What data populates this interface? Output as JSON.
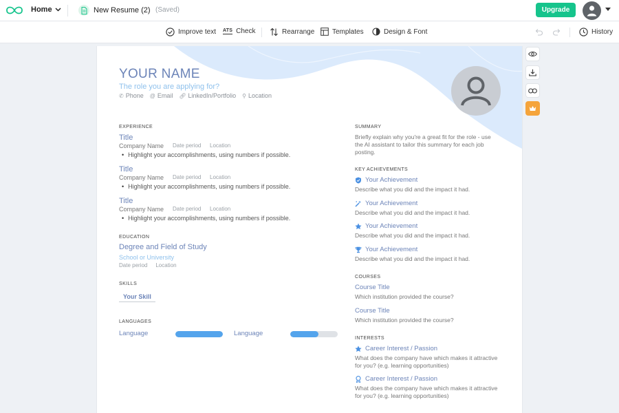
{
  "topbar": {
    "home_label": "Home",
    "document_title": "New Resume (2)",
    "save_status": "(Saved)",
    "upgrade_label": "Upgrade"
  },
  "toolbar": {
    "improve_text": "Improve text",
    "ats_badge": "ATS",
    "check": "Check",
    "rearrange": "Rearrange",
    "templates": "Templates",
    "design_font": "Design & Font",
    "history": "History"
  },
  "resume": {
    "name": "YOUR NAME",
    "role": "The role you are applying for?",
    "contacts": {
      "phone": "Phone",
      "email": "Email",
      "linkedin": "LinkedIn/Portfolio",
      "location": "Location"
    },
    "experience": {
      "heading": "EXPERIENCE",
      "items": [
        {
          "title": "Title",
          "company": "Company Name",
          "period": "Date period",
          "location": "Location",
          "bullet": "Highlight your accomplishments, using numbers if possible."
        },
        {
          "title": "Title",
          "company": "Company Name",
          "period": "Date period",
          "location": "Location",
          "bullet": "Highlight your accomplishments, using numbers if possible."
        },
        {
          "title": "Title",
          "company": "Company Name",
          "period": "Date period",
          "location": "Location",
          "bullet": "Highlight your accomplishments, using numbers if possible."
        }
      ]
    },
    "education": {
      "heading": "EDUCATION",
      "degree": "Degree and Field of Study",
      "school": "School or University",
      "period": "Date period",
      "location": "Location"
    },
    "skills": {
      "heading": "SKILLS",
      "items": [
        "Your Skill"
      ]
    },
    "languages": {
      "heading": "LANGUAGES",
      "items": [
        {
          "name": "Language",
          "level": 1.0
        },
        {
          "name": "Language",
          "level": 0.6
        }
      ]
    },
    "summary": {
      "heading": "SUMMARY",
      "text": "Briefly explain why you're a great fit for the role - use the AI assistant to tailor this summary for each job posting."
    },
    "achievements": {
      "heading": "KEY ACHIEVEMENTS",
      "items": [
        {
          "icon": "shield-icon",
          "title": "Your Achievement",
          "text": "Describe what you did and the impact it had."
        },
        {
          "icon": "magic-wand-icon",
          "title": "Your Achievement",
          "text": "Describe what you did and the impact it had."
        },
        {
          "icon": "star-icon",
          "title": "Your Achievement",
          "text": "Describe what you did and the impact it had."
        },
        {
          "icon": "trophy-icon",
          "title": "Your Achievement",
          "text": "Describe what you did and the impact it had."
        }
      ]
    },
    "courses": {
      "heading": "COURSES",
      "items": [
        {
          "title": "Course Title",
          "text": "Which institution provided the course?"
        },
        {
          "title": "Course Title",
          "text": "Which institution provided the course?"
        }
      ]
    },
    "interests": {
      "heading": "INTERESTS",
      "items": [
        {
          "icon": "star-icon",
          "title": "Career Interest / Passion",
          "text": "What does the company have which makes it attractive for you? (e.g. learning opportunities)"
        },
        {
          "icon": "medal-icon",
          "title": "Career Interest / Passion",
          "text": "What does the company have which makes it attractive for you? (e.g. learning opportunities)"
        }
      ]
    }
  },
  "colors": {
    "accent": "#6c84b8",
    "role": "#8fc1ec",
    "upgrade": "#16c48c",
    "premium": "#f5a43b",
    "language_bar": "#54a4ec",
    "header_wave": "#dbeafc"
  }
}
